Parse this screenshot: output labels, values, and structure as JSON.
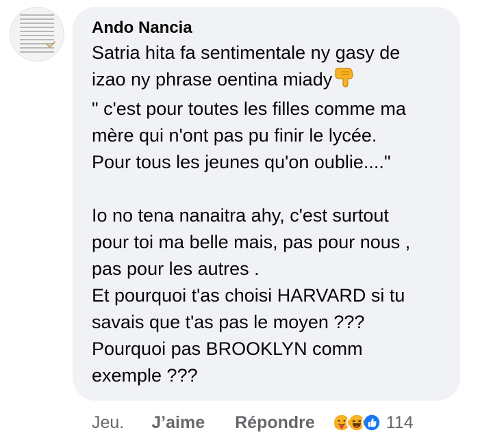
{
  "comment": {
    "author": "Ando Nancia",
    "lines_part1": [
      "Satria hita fa sentimentale ny gasy de",
      "izao ny phrase oentina miady",
      "\" c'est pour toutes les filles comme ma",
      "mère qui n'ont pas pu finir le lycée.",
      "Pour tous les jeunes qu'on oublie....\""
    ],
    "lines_part2": [
      "Io no tena nanaitra ahy, c'est surtout",
      "pour toi ma belle mais, pas pour nous ,",
      "pas pour les autres .",
      "Et pourquoi t'as choisi HARVARD si tu",
      "savais que t'as pas le moyen ???",
      "Pourquoi pas BROOKLYN comm",
      "exemple ???"
    ],
    "inline_emoji": "backhand-index-pointing-down"
  },
  "actions": {
    "time": "Jeu.",
    "like_label": "J’aime",
    "reply_label": "Répondre",
    "reaction_count": "114",
    "reactions": [
      "care",
      "haha",
      "like"
    ]
  },
  "colors": {
    "bubble_bg": "#f0f2f5",
    "text": "#050505",
    "secondary_text": "#65676b",
    "like_blue": "#1877f2",
    "emoji_yellow": "#f7b125"
  }
}
